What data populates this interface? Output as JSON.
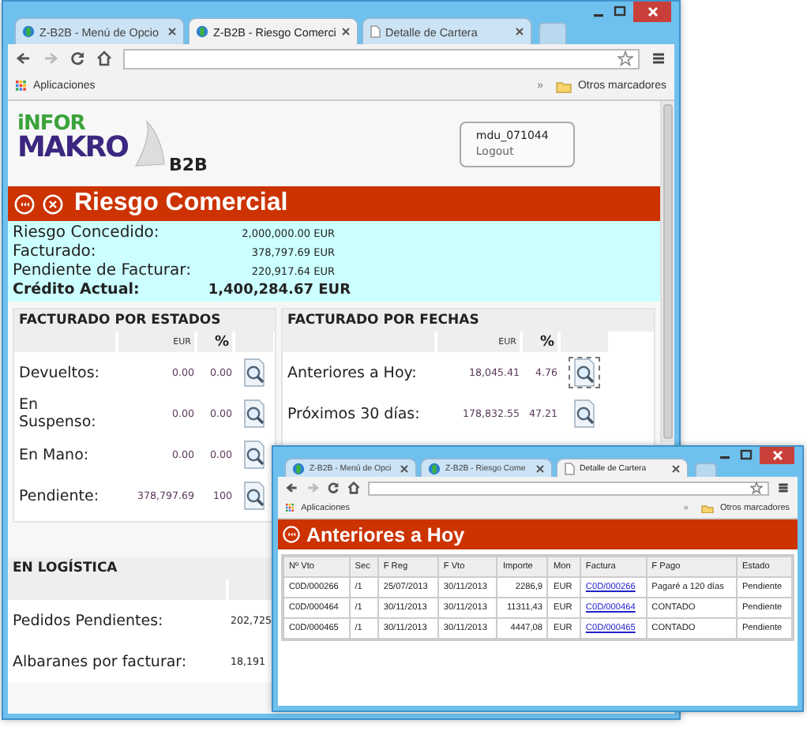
{
  "main_window": {
    "tabs": [
      {
        "label": "Z-B2B - Menú de Opcio",
        "kind": "app",
        "selected": false
      },
      {
        "label": "Z-B2B - Riesgo Comerci",
        "kind": "app",
        "selected": true
      },
      {
        "label": "Detalle de Cartera",
        "kind": "page",
        "selected": false
      }
    ],
    "bookmarks": {
      "apps": "Aplicaciones",
      "overflow": "»",
      "folder": "Otros marcadores"
    },
    "header": {
      "logo_top": "iNFOR",
      "logo_bottom": "MAKRO",
      "product": "B2B",
      "user": "mdu_071044",
      "logout": "Logout"
    },
    "title": "Riesgo Comercial",
    "summary": [
      {
        "label": "Riesgo Concedido:",
        "value": "2,000,000.00 EUR",
        "bold": false
      },
      {
        "label": "Facturado:",
        "value": "378,797.69 EUR",
        "bold": false
      },
      {
        "label": "Pendiente de Facturar:",
        "value": "220,917.64 EUR",
        "bold": false
      },
      {
        "label": "Crédito Actual:",
        "value": "1,400,284.67 EUR",
        "bold": true
      }
    ],
    "estados": {
      "title": "FACTURADO POR ESTADOS",
      "columns": [
        "EUR",
        "%"
      ],
      "rows": [
        {
          "label": "Devueltos:",
          "amount": "0.00",
          "percent": "0.00",
          "focused": false
        },
        {
          "label": "En Suspenso:",
          "amount": "0.00",
          "percent": "0.00",
          "focused": false
        },
        {
          "label": "En Mano:",
          "amount": "0.00",
          "percent": "0.00",
          "focused": false
        },
        {
          "label": "Pendiente:",
          "amount": "378,797.69",
          "percent": "100",
          "focused": false
        }
      ]
    },
    "fechas": {
      "title": "FACTURADO POR FECHAS",
      "columns": [
        "EUR",
        "%"
      ],
      "rows": [
        {
          "label": "Anteriores a Hoy:",
          "amount": "18,045.41",
          "percent": "4.76",
          "focused": true
        },
        {
          "label": "Próximos 30 días:",
          "amount": "178,832.55",
          "percent": "47.21",
          "focused": false
        }
      ]
    },
    "logistica": {
      "title": "EN LOGÍSTICA",
      "rows": [
        {
          "label": "Pedidos Pendientes:",
          "amount": "202,725"
        },
        {
          "label": "Albaranes por facturar:",
          "amount": "18,191"
        }
      ]
    }
  },
  "detail_window": {
    "tabs": [
      {
        "label": "Z-B2B - Menú de Opci",
        "kind": "app",
        "selected": false
      },
      {
        "label": "Z-B2B - Riesgo Come",
        "kind": "app",
        "selected": false
      },
      {
        "label": "Detalle de Cartera",
        "kind": "page",
        "selected": true
      }
    ],
    "bookmarks": {
      "apps": "Aplicaciones",
      "overflow": "»",
      "folder": "Otros marcadores"
    },
    "title": "Anteriores a Hoy",
    "table": {
      "columns": [
        {
          "label": "Nº Vto",
          "kind": "text"
        },
        {
          "label": "Sec",
          "kind": "text"
        },
        {
          "label": "F Reg",
          "kind": "text"
        },
        {
          "label": "F Vto",
          "kind": "text"
        },
        {
          "label": "Importe",
          "kind": "number"
        },
        {
          "label": "Mon",
          "kind": "text"
        },
        {
          "label": "Factura",
          "kind": "link"
        },
        {
          "label": "F Pago",
          "kind": "text"
        },
        {
          "label": "Estado",
          "kind": "text"
        }
      ],
      "rows": [
        [
          "C0D/000266",
          "/1",
          "25/07/2013",
          "30/11/2013",
          "2286,9",
          "EUR",
          "C0D/000266",
          "Pagaré a 120 días",
          "Pendiente"
        ],
        [
          "C0D/000464",
          "/1",
          "30/11/2013",
          "30/11/2013",
          "11311,43",
          "EUR",
          "C0D/000464",
          "CONTADO",
          "Pendiente"
        ],
        [
          "C0D/000465",
          "/1",
          "30/11/2013",
          "30/11/2013",
          "4447,08",
          "EUR",
          "C0D/000465",
          "CONTADO",
          "Pendiente"
        ]
      ]
    }
  }
}
